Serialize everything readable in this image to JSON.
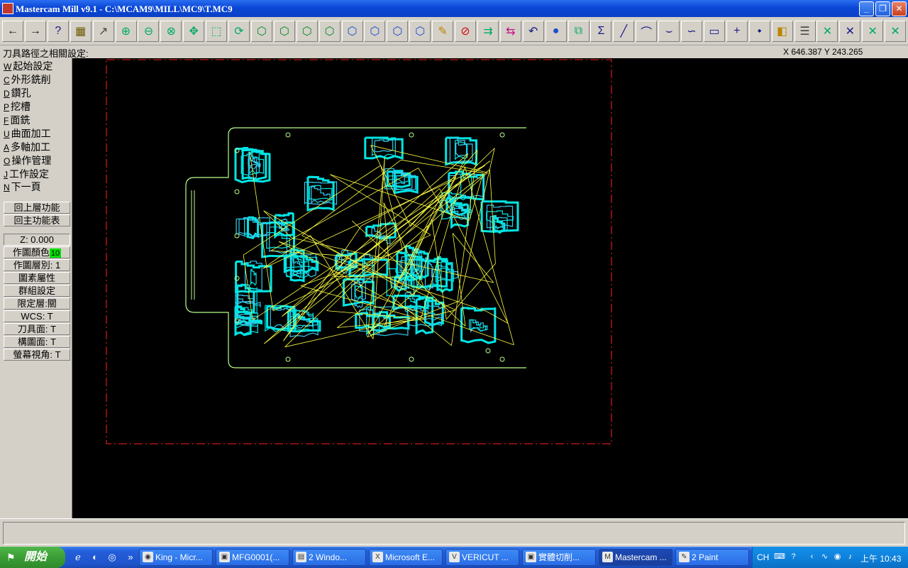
{
  "window": {
    "title": "Mastercam Mill v9.1 - C:\\MCAM9\\MILL\\MC9\\T.MC9",
    "minimize_glyph": "_",
    "restore_glyph": "❐",
    "close_glyph": "✕"
  },
  "toolbar": {
    "buttons": [
      {
        "name": "back-icon",
        "glyph": "←"
      },
      {
        "name": "forward-icon",
        "glyph": "→"
      },
      {
        "name": "help-icon",
        "glyph": "?"
      },
      {
        "name": "calculator-icon",
        "glyph": "▦"
      },
      {
        "name": "analyze-icon",
        "glyph": "↗"
      },
      {
        "name": "zoom-window-icon",
        "glyph": "⊕"
      },
      {
        "name": "zoom-out-icon",
        "glyph": "⊖"
      },
      {
        "name": "zoom-fit-icon",
        "glyph": "⊗"
      },
      {
        "name": "pan-icon",
        "glyph": "✥"
      },
      {
        "name": "select-icon",
        "glyph": "⬚"
      },
      {
        "name": "rotate-view-icon",
        "glyph": "⟳"
      },
      {
        "name": "view-top-icon",
        "glyph": "⬡"
      },
      {
        "name": "view-front-icon",
        "glyph": "⬡"
      },
      {
        "name": "view-side-icon",
        "glyph": "⬡"
      },
      {
        "name": "view-iso-icon",
        "glyph": "⬡"
      },
      {
        "name": "cplane-top-icon",
        "glyph": "⬡"
      },
      {
        "name": "cplane-front-icon",
        "glyph": "⬡"
      },
      {
        "name": "cplane-side-icon",
        "glyph": "⬡"
      },
      {
        "name": "cplane-3d-icon",
        "glyph": "⬡"
      },
      {
        "name": "pencil-icon",
        "glyph": "✎"
      },
      {
        "name": "delete-icon",
        "glyph": "⊘"
      },
      {
        "name": "transform-icon",
        "glyph": "⇉"
      },
      {
        "name": "translate-icon",
        "glyph": "⇆"
      },
      {
        "name": "undo-icon",
        "glyph": "↶"
      },
      {
        "name": "shade-sphere-icon",
        "glyph": "●"
      },
      {
        "name": "group-icon",
        "glyph": "⧉"
      },
      {
        "name": "sum-icon",
        "glyph": "Σ"
      },
      {
        "name": "line-icon",
        "glyph": "╱"
      },
      {
        "name": "arc-icon",
        "glyph": "⌒"
      },
      {
        "name": "fillet-icon",
        "glyph": "⌣"
      },
      {
        "name": "spline-icon",
        "glyph": "∽"
      },
      {
        "name": "rectangle-icon",
        "glyph": "▭"
      },
      {
        "name": "point-icon",
        "glyph": "+"
      },
      {
        "name": "surface-icon",
        "glyph": "⬩"
      },
      {
        "name": "solid-icon",
        "glyph": "◧"
      },
      {
        "name": "ops-manager-icon",
        "glyph": "☰"
      },
      {
        "name": "trim-1-icon",
        "glyph": "✕"
      },
      {
        "name": "trim-2-icon",
        "glyph": "✕"
      },
      {
        "name": "trim-3-icon",
        "glyph": "✕"
      },
      {
        "name": "trim-divide-icon",
        "glyph": "✕"
      }
    ]
  },
  "prompt": {
    "text": "刀具路徑之相關設定:",
    "coords": "X 646.387   Y 243.265"
  },
  "menu": {
    "items": [
      {
        "key": "W",
        "label": "起始設定"
      },
      {
        "key": "C",
        "label": "外形銑削"
      },
      {
        "key": "D",
        "label": "鑽孔"
      },
      {
        "key": "P",
        "label": "挖槽"
      },
      {
        "key": "F",
        "label": "面銑"
      },
      {
        "key": "U",
        "label": "曲面加工"
      },
      {
        "key": "A",
        "label": "多軸加工"
      },
      {
        "key": "O",
        "label": "操作管理"
      },
      {
        "key": "J",
        "label": "工作設定"
      },
      {
        "key": "N",
        "label": "下一頁"
      }
    ],
    "back_label": "回上層功能",
    "main_label": "回主功能表"
  },
  "settings": {
    "z_value": "Z:   0.000",
    "color_label": "作圖顏色",
    "color_value": "10",
    "level_label": "作圖層別:  1",
    "attributes_label": "圖素屬性",
    "groups_label": "群組設定",
    "mask_label": "限定層:關",
    "wcs_label": "WCS:   T",
    "tplane_label": "刀具面:  T",
    "cplane_label": "構圖面:  T",
    "gview_label": "螢幕視角:  T"
  },
  "colors": {
    "canvas_bg": "#000000",
    "toolpath_cyan": "#00e5e5",
    "rapid_yellow": "#ffff40",
    "geometry_green": "#b8ff8a",
    "boundary_red": "#ff2020"
  },
  "taskbar": {
    "start_label": "開始",
    "quick_launch": [
      "ie-icon",
      "media-icon",
      "chrome-icon"
    ],
    "tasks": [
      {
        "label": "King - Micr...",
        "icon": "◉"
      },
      {
        "label": "MFG0001(...",
        "icon": "▣"
      },
      {
        "label": "2 Windo...",
        "icon": "▤"
      },
      {
        "label": "Microsoft E...",
        "icon": "X"
      },
      {
        "label": "VERICUT ...",
        "icon": "V"
      },
      {
        "label": "實體切削...",
        "icon": "▣"
      },
      {
        "label": "Mastercam ...",
        "icon": "M"
      },
      {
        "label": "2 Paint",
        "icon": "✎"
      }
    ],
    "tray": {
      "language": "CH",
      "clock": "上午 10:43"
    }
  }
}
